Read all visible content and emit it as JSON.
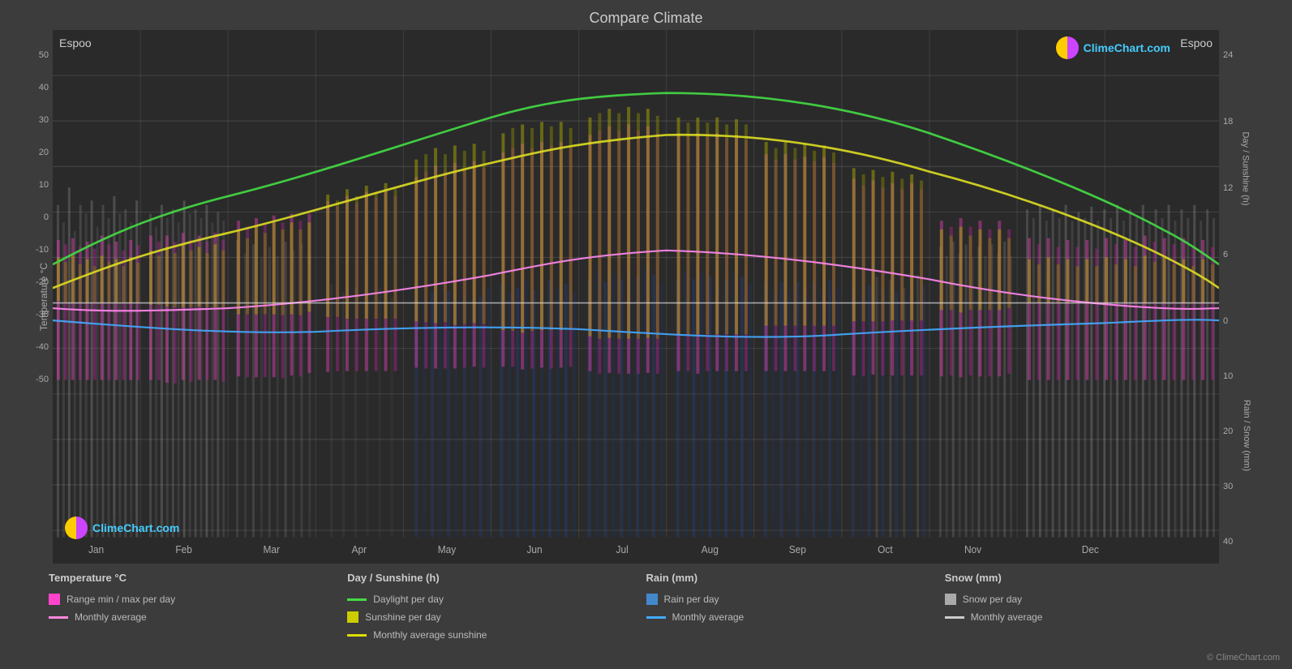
{
  "title": "Compare Climate",
  "city_left": "Espoo",
  "city_right": "Espoo",
  "logo_text": "ClimeChart.com",
  "copyright": "© ClimeChart.com",
  "left_axis": {
    "label": "Temperature °C",
    "ticks": [
      "50",
      "40",
      "30",
      "20",
      "10",
      "0",
      "-10",
      "-20",
      "-30",
      "-40",
      "-50"
    ]
  },
  "right_axis_top": {
    "label": "Day / Sunshine (h)",
    "ticks": [
      "24",
      "18",
      "12",
      "6",
      "0"
    ]
  },
  "right_axis_bottom": {
    "label": "Rain / Snow (mm)",
    "ticks": [
      "0",
      "10",
      "20",
      "30",
      "40"
    ]
  },
  "months": [
    "Jan",
    "Feb",
    "Mar",
    "Apr",
    "May",
    "Jun",
    "Jul",
    "Aug",
    "Sep",
    "Oct",
    "Nov",
    "Dec"
  ],
  "legend": {
    "groups": [
      {
        "title": "Temperature °C",
        "items": [
          {
            "type": "rect",
            "color": "#ff44cc",
            "label": "Range min / max per day"
          },
          {
            "type": "line",
            "color": "#ff88dd",
            "label": "Monthly average"
          }
        ]
      },
      {
        "title": "Day / Sunshine (h)",
        "items": [
          {
            "type": "line",
            "color": "#44dd44",
            "label": "Daylight per day"
          },
          {
            "type": "rect",
            "color": "#cccc00",
            "label": "Sunshine per day"
          },
          {
            "type": "line",
            "color": "#dddd00",
            "label": "Monthly average sunshine"
          }
        ]
      },
      {
        "title": "Rain (mm)",
        "items": [
          {
            "type": "rect",
            "color": "#4488cc",
            "label": "Rain per day"
          },
          {
            "type": "line",
            "color": "#44aaff",
            "label": "Monthly average"
          }
        ]
      },
      {
        "title": "Snow (mm)",
        "items": [
          {
            "type": "rect",
            "color": "#aaaaaa",
            "label": "Snow per day"
          },
          {
            "type": "line",
            "color": "#cccccc",
            "label": "Monthly average"
          }
        ]
      }
    ]
  }
}
